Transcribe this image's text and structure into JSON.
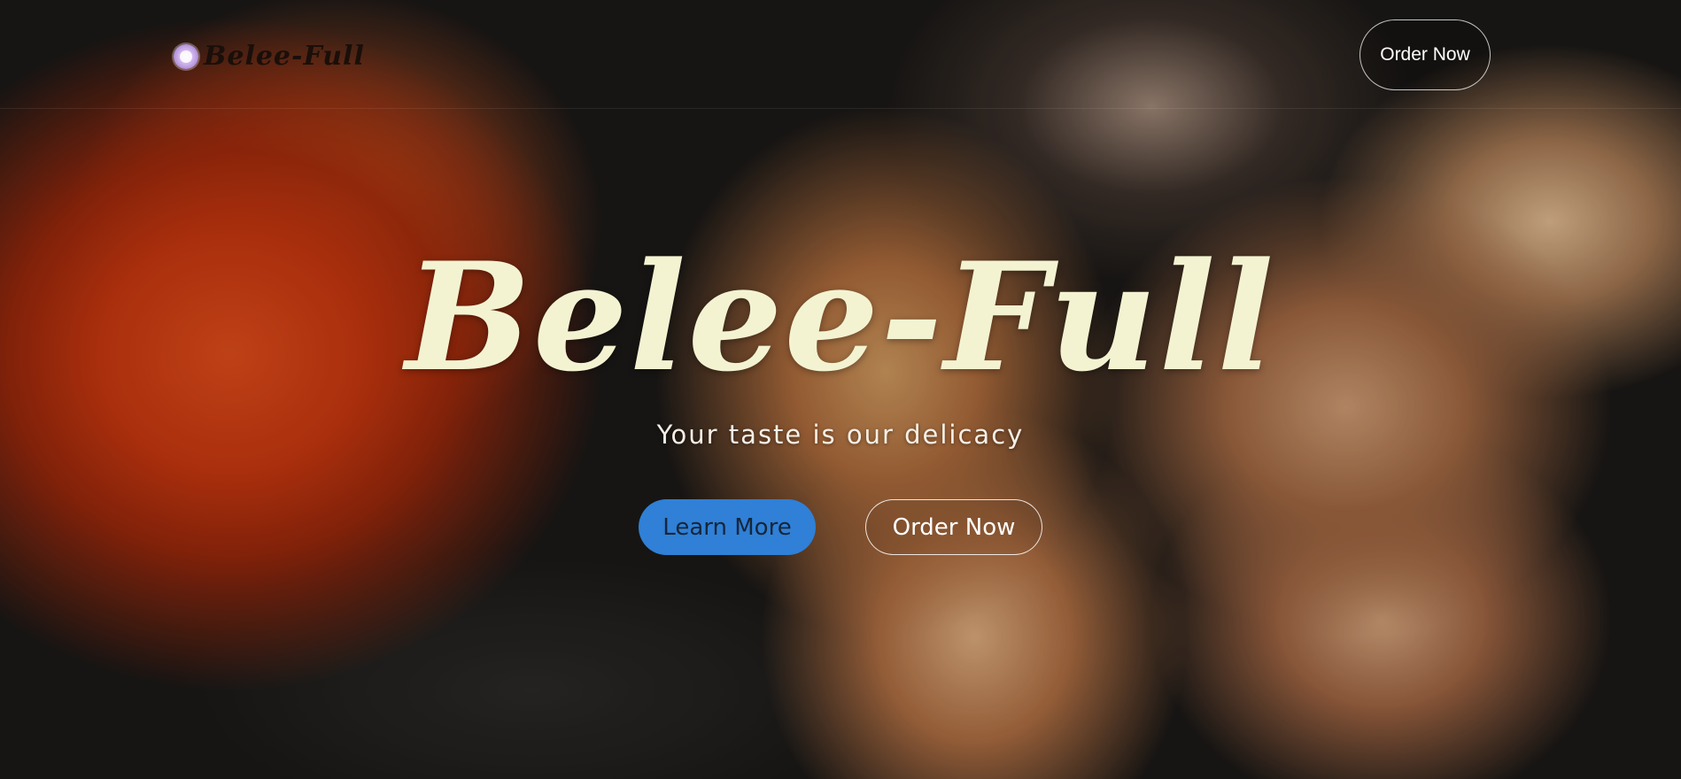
{
  "navbar": {
    "brand_icon": "plate-icon",
    "brand_name": "Belee-Full",
    "order_label": "Order Now"
  },
  "hero": {
    "title": "Belee-Full",
    "subtitle": "Your taste is our delicacy",
    "learn_more_label": "Learn More",
    "order_now_label": "Order Now"
  },
  "colors": {
    "title": "#f3f3d2",
    "learn_more_bg": "#2f80d6",
    "learn_more_text": "#16263a"
  }
}
